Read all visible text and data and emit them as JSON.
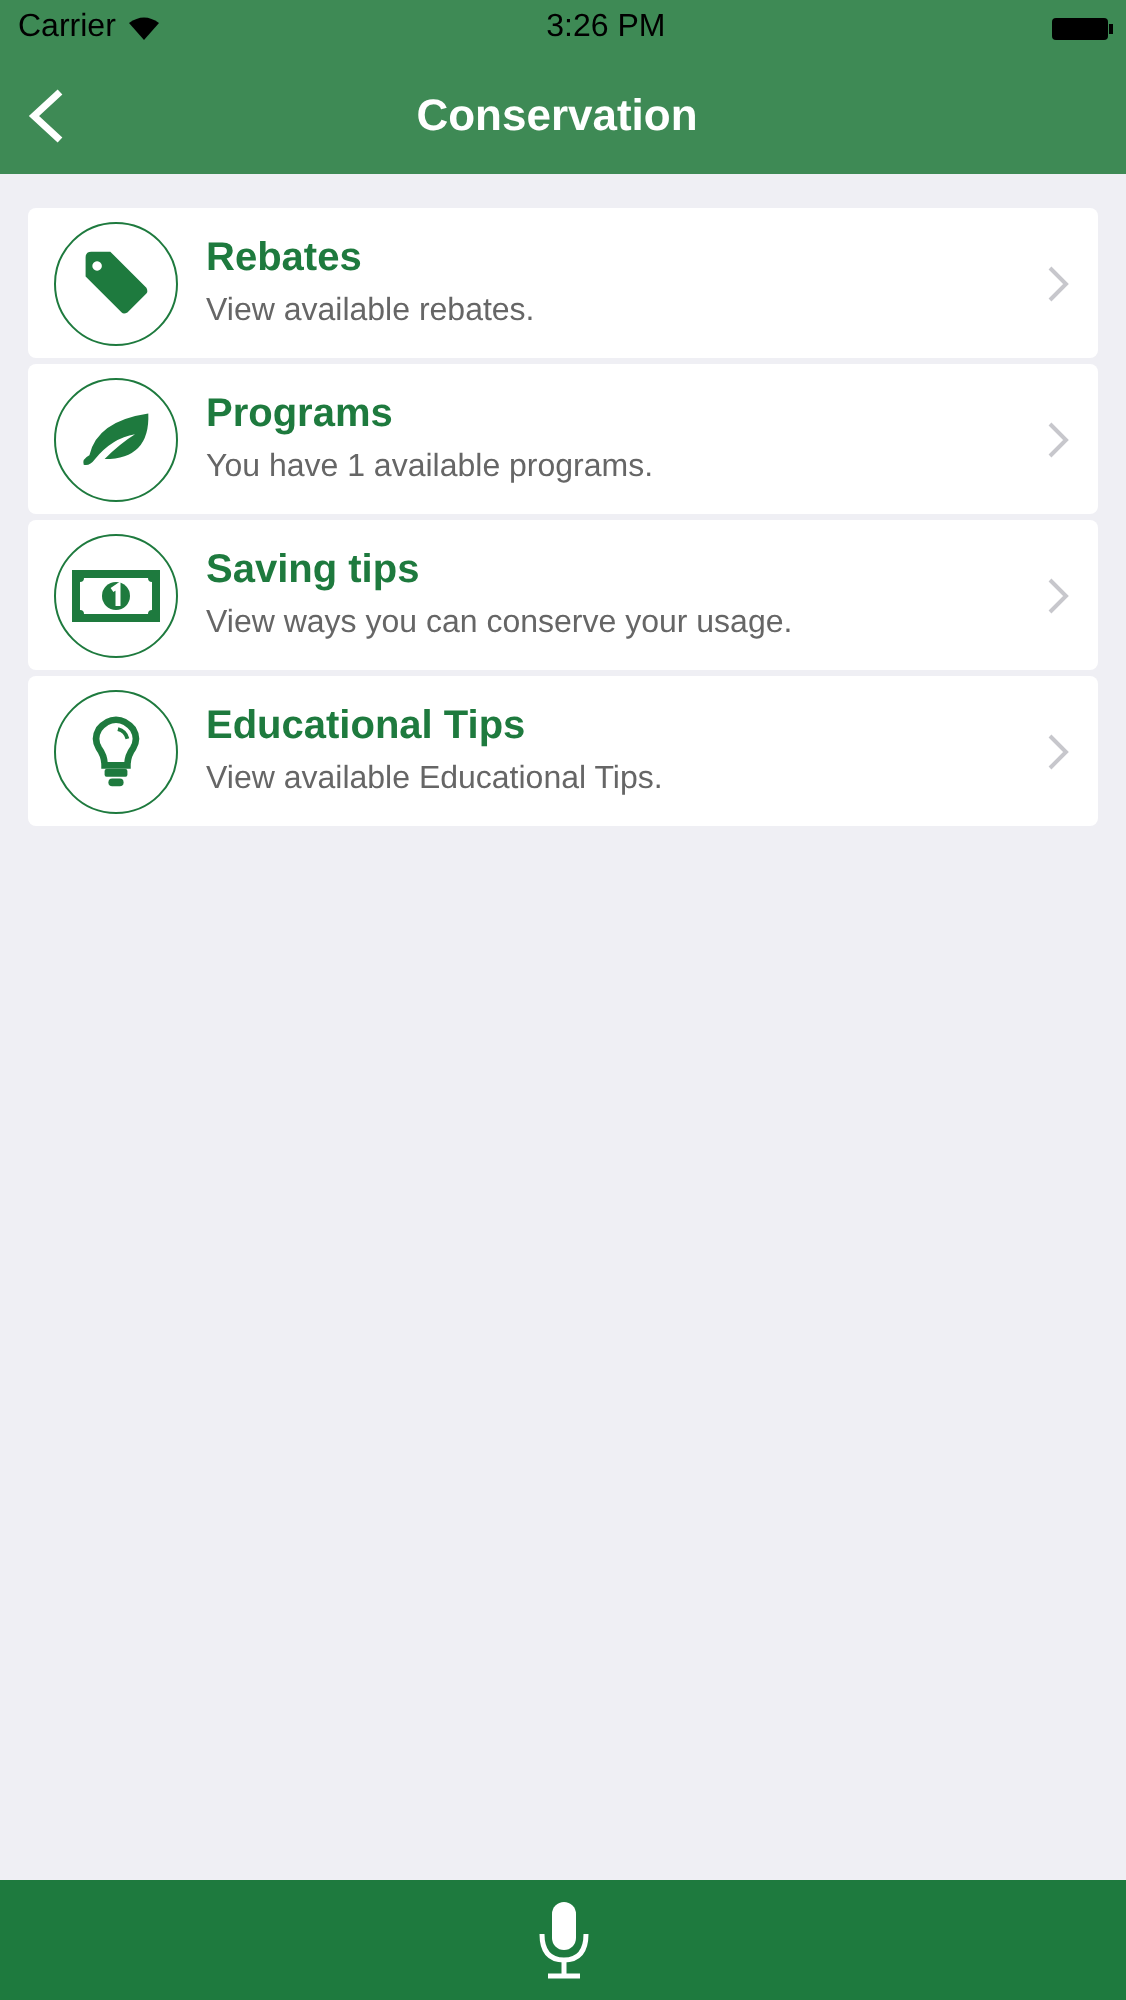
{
  "status_bar": {
    "carrier": "Carrier",
    "time": "3:26 PM"
  },
  "nav": {
    "title": "Conservation"
  },
  "items": [
    {
      "kind": "tag",
      "title": "Rebates",
      "subtitle": "View available rebates."
    },
    {
      "kind": "leaf",
      "title": "Programs",
      "subtitle": "You have 1 available programs."
    },
    {
      "kind": "money",
      "title": "Saving tips",
      "subtitle": "View ways you can conserve your usage."
    },
    {
      "kind": "bulb",
      "title": "Educational Tips",
      "subtitle": "View available Educational Tips."
    }
  ]
}
